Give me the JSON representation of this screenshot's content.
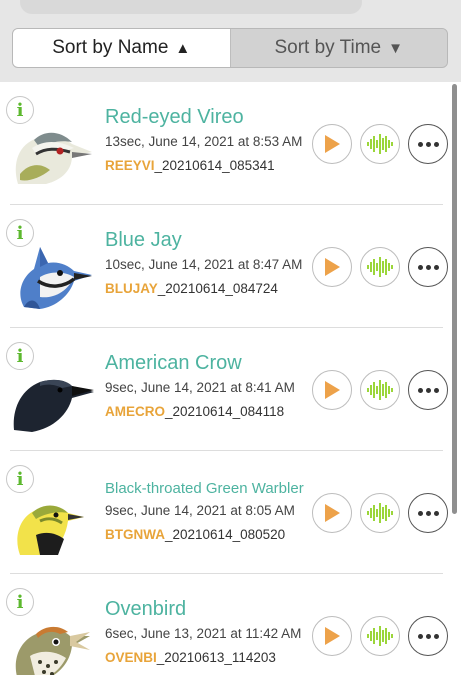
{
  "sort": {
    "by_name_label": "Sort by Name",
    "by_name_arrow": "▲",
    "by_time_label": "Sort by Time",
    "by_time_arrow": "▼",
    "active": "name"
  },
  "recordings": [
    {
      "name": "Red-eyed Vireo",
      "meta": "13sec, June 14, 2021 at 8:53 AM",
      "code": "REEYVI",
      "file_suffix": "_20210614_085341",
      "bird_icon": "red-eyed-vireo"
    },
    {
      "name": "Blue Jay",
      "meta": "10sec, June 14, 2021 at 8:47 AM",
      "code": "BLUJAY",
      "file_suffix": "_20210614_084724",
      "bird_icon": "blue-jay"
    },
    {
      "name": "American Crow",
      "meta": "9sec, June 14, 2021 at 8:41 AM",
      "code": "AMECRO",
      "file_suffix": "_20210614_084118",
      "bird_icon": "american-crow"
    },
    {
      "name": "Black-throated Green Warbler",
      "meta": "9sec, June 14, 2021 at 8:05 AM",
      "code": "BTGNWA",
      "file_suffix": "_20210614_080520",
      "bird_icon": "black-throated-green-warbler"
    },
    {
      "name": "Ovenbird",
      "meta": "6sec, June 13, 2021 at 11:42 AM",
      "code": "OVENBI",
      "file_suffix": "_20210613_114203",
      "bird_icon": "ovenbird"
    }
  ],
  "icons": {
    "info": "i",
    "play": "play-icon",
    "waveform": "waveform-icon",
    "more": "more-icon"
  },
  "colors": {
    "name_teal": "#4db3a0",
    "code_orange": "#e8a43a",
    "play_orange": "#eda24a",
    "wave_green": "#9bd63a",
    "info_green": "#5cb82e"
  }
}
